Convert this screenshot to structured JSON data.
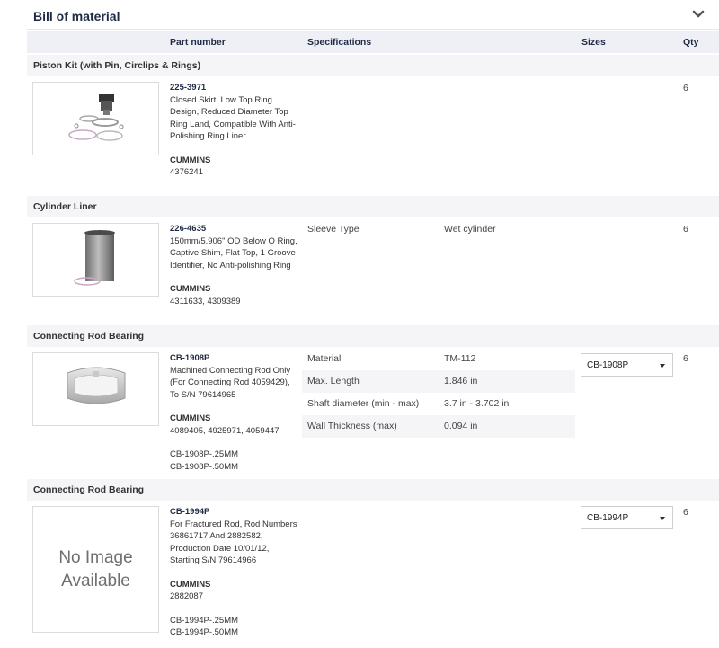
{
  "panel": {
    "title": "Bill of material"
  },
  "columns": {
    "part_number": "Part number",
    "specifications": "Specifications",
    "sizes": "Sizes",
    "qty": "Qty"
  },
  "rows": [
    {
      "section": "Piston Kit (with Pin, Circlips & Rings)",
      "part_number": "225-3971",
      "description": "Closed Skirt, Low Top Ring Design, Reduced Diameter Top Ring Land, Compatible With Anti-Polishing Ring Liner",
      "manufacturer": "CUMMINS",
      "oem_numbers": "4376241",
      "qty": "6"
    },
    {
      "section": "Cylinder Liner",
      "part_number": "226-4635",
      "description": "150mm/5.906\" OD Below O Ring, Captive Shim, Flat Top, 1 Groove Identifier, No Anti-polishing Ring",
      "manufacturer": "CUMMINS",
      "oem_numbers": "4311633, 4309389",
      "specs": [
        {
          "label": "Sleeve Type",
          "value": "Wet cylinder"
        }
      ],
      "qty": "6"
    },
    {
      "section": "Connecting Rod Bearing",
      "part_number": "CB-1908P",
      "description": "Machined Connecting Rod Only (For Connecting Rod 4059429), To S/N 79614965",
      "manufacturer": "CUMMINS",
      "oem_numbers": "4089405, 4925971, 4059447",
      "size_variants": [
        "CB-1908P-.25MM",
        "CB-1908P-.50MM"
      ],
      "specs": [
        {
          "label": "Material",
          "value": "TM-112"
        },
        {
          "label": "Max. Length",
          "value": "1.846 in"
        },
        {
          "label": "Shaft diameter (min - max)",
          "value": "3.7 in - 3.702 in"
        },
        {
          "label": "Wall Thickness (max)",
          "value": "0.094 in"
        }
      ],
      "size_selected": "CB-1908P",
      "qty": "6"
    },
    {
      "section": "Connecting Rod Bearing",
      "part_number": "CB-1994P",
      "description": "For Fractured Rod, Rod Numbers 36861717 And 2882582, Production Date 10/01/12, Starting S/N 79614966",
      "manufacturer": "CUMMINS",
      "oem_numbers": "2882087",
      "size_variants": [
        "CB-1994P-.25MM",
        "CB-1994P-.50MM"
      ],
      "no_image_text": [
        "No Image",
        "Available"
      ],
      "size_selected": "CB-1994P",
      "qty": "6"
    }
  ],
  "icons": {
    "collapse": "chevron-down-icon",
    "dropdown": "caret-down-icon"
  },
  "colors": {
    "title": "#1f2a44",
    "header_bg": "#eef0f5",
    "section_bg": "#f5f5f7"
  }
}
